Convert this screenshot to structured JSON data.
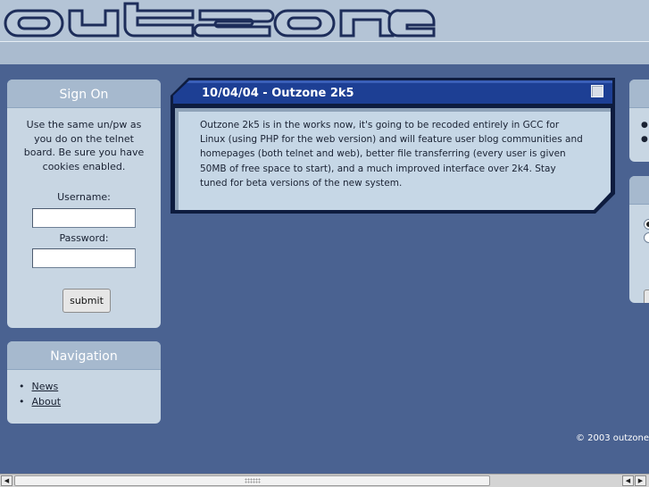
{
  "header": {
    "logo_text": "outzone"
  },
  "signon": {
    "title": "Sign On",
    "description": "Use the same un/pw as you do on the telnet board. Be sure you have cookies enabled.",
    "username_label": "Username:",
    "username_value": "",
    "password_label": "Password:",
    "password_value": "",
    "submit_label": "submit"
  },
  "navigation": {
    "title": "Navigation",
    "items": [
      {
        "label": "News"
      },
      {
        "label": "About"
      }
    ]
  },
  "news": {
    "title": "10/04/04 - Outzone 2k5",
    "body": "Outzone 2k5 is in the works now, it's going to be recoded entirely in GCC for Linux (using PHP for the web version) and will feature user blog communities and homepages (both telnet and web), better file transferring (every user is given 50MB of free space to start), and a much improved interface over 2k4. Stay tuned for beta versions of the new system."
  },
  "footer": {
    "copyright": "© 2003 outzone"
  },
  "scrollbar": {
    "left_arrow": "◀",
    "right_arrow": "▶"
  },
  "colors": {
    "page_background": "#4a6291",
    "header_background": "#b4c4d6",
    "box_background": "#c8d6e3",
    "box_title_background": "#a6b9ce",
    "news_title_bar": "#1a3a8c",
    "news_body": "#c6d7e6"
  }
}
